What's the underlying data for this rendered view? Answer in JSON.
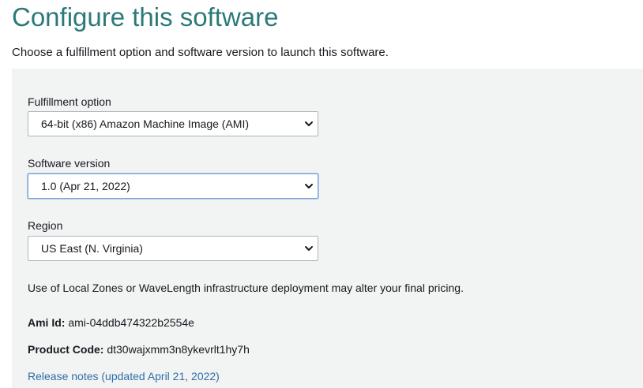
{
  "page": {
    "title": "Configure this software",
    "subtitle": "Choose a fulfillment option and software version to launch this software."
  },
  "fulfillment": {
    "label": "Fulfillment option",
    "value": "64-bit (x86) Amazon Machine Image (AMI)"
  },
  "software_version": {
    "label": "Software version",
    "value": "1.0 (Apr 21, 2022)"
  },
  "region": {
    "label": "Region",
    "value": "US East (N. Virginia)"
  },
  "notice": "Use of Local Zones or WaveLength infrastructure deployment may alter your final pricing.",
  "ami": {
    "label": "Ami Id:",
    "value": "ami-04ddb474322b2554e"
  },
  "product_code": {
    "label": "Product Code:",
    "value": "dt30wajxmm3n8ykevrlt1hy7h"
  },
  "release_notes": "Release notes (updated April 21, 2022)",
  "icons": {
    "dropdown": "chevron-down-icon"
  },
  "colors": {
    "title": "#2b7a78",
    "link": "#2f6ea6",
    "panel": "#f2f3f3"
  }
}
